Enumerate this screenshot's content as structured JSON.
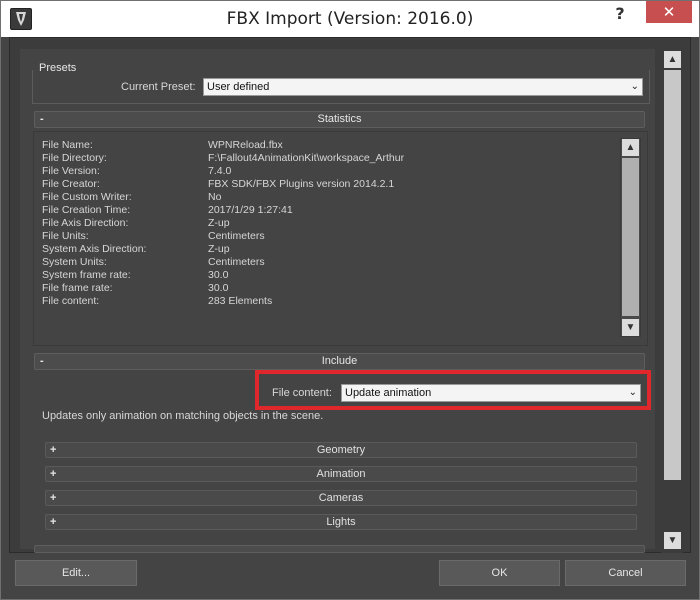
{
  "window": {
    "title": "FBX Import (Version: 2016.0)",
    "help_symbol": "?",
    "close_symbol": "✕"
  },
  "presets": {
    "legend": "Presets",
    "current_preset_label": "Current Preset:",
    "current_preset_value": "User defined"
  },
  "statistics": {
    "header": "Statistics",
    "toggle": "-",
    "rows": [
      {
        "label": "File Name:",
        "value": "WPNReload.fbx"
      },
      {
        "label": "File Directory:",
        "value": "F:\\Fallout4AnimationKit\\workspace_Arthur"
      },
      {
        "label": "File Version:",
        "value": "7.4.0"
      },
      {
        "label": "File Creator:",
        "value": "FBX SDK/FBX Plugins version 2014.2.1"
      },
      {
        "label": "File Custom Writer:",
        "value": "No"
      },
      {
        "label": "File Creation Time:",
        "value": "2017/1/29  1:27:41"
      },
      {
        "label": "File Axis Direction:",
        "value": "Z-up"
      },
      {
        "label": "File Units:",
        "value": "Centimeters"
      },
      {
        "label": "System Axis Direction:",
        "value": "Z-up"
      },
      {
        "label": "System Units:",
        "value": "Centimeters"
      },
      {
        "label": "System frame rate:",
        "value": "30.0"
      },
      {
        "label": "File frame rate:",
        "value": "30.0"
      },
      {
        "label": "File content:",
        "value": "283 Elements"
      }
    ]
  },
  "include": {
    "header": "Include",
    "toggle": "-",
    "file_content_label": "File content:",
    "file_content_value": "Update animation",
    "description": "Updates only animation on matching objects in the scene.",
    "sub_rollouts": [
      {
        "toggle": "+",
        "label": "Geometry"
      },
      {
        "toggle": "+",
        "label": "Animation"
      },
      {
        "toggle": "+",
        "label": "Cameras"
      },
      {
        "toggle": "+",
        "label": "Lights"
      }
    ]
  },
  "scroll": {
    "up": "▲",
    "down": "▼"
  },
  "footer": {
    "edit_label": "Edit...",
    "ok_label": "OK",
    "cancel_label": "Cancel"
  },
  "colors": {
    "panel": "#444444",
    "highlight": "#e0272c",
    "close": "#c74f4f"
  }
}
